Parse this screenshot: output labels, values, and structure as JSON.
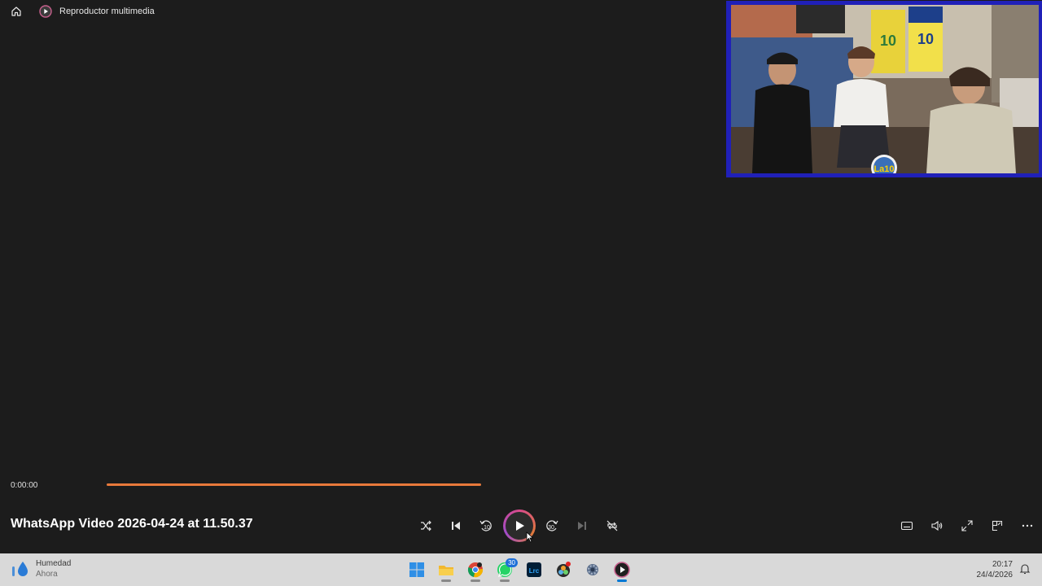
{
  "app": {
    "title": "Reproductor multimedia"
  },
  "player": {
    "current_time": "0:00:00",
    "progress_fraction": 0.0,
    "buffer_fill_color": "#e8793b",
    "media_title": "WhatsApp Video 2026-04-24 at 11.50.37"
  },
  "controls": [
    "shuffle-icon",
    "previous-icon",
    "rewind-10-icon",
    "play-icon",
    "forward-30-icon",
    "next-icon",
    "repeat-icon"
  ],
  "controls_labels": {
    "rewind": "10",
    "forward": "30"
  },
  "right_controls": [
    "subtitles-icon",
    "volume-icon",
    "fullscreen-icon",
    "miniplayer-icon",
    "more-icon"
  ],
  "pip_overlay": {
    "border_color": "#2020b8",
    "jersey_1_number": "10",
    "jersey_2_number": "10",
    "logo_text": "La10"
  },
  "taskbar": {
    "weather_title": "Humedad",
    "weather_subtitle": "Ahora",
    "apps": [
      "windows-start-icon",
      "file-explorer-icon",
      "chrome-icon",
      "whatsapp-icon",
      "lightroom-icon",
      "davinci-icon",
      "settings-icon",
      "media-player-icon"
    ],
    "whatsapp_badge": "30",
    "lightroom_label": "Lrc",
    "time": "20:17",
    "date": "24/4/2026"
  }
}
